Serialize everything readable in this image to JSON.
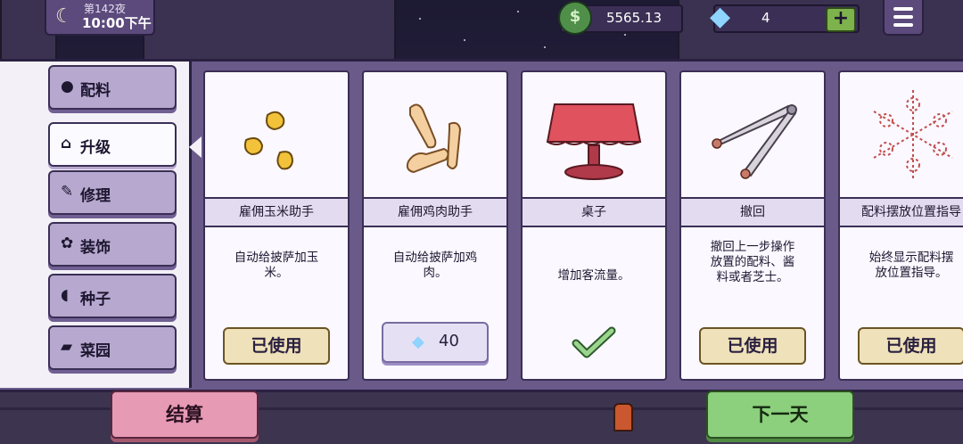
{
  "hud": {
    "night_label": "第142夜",
    "time": "10:00下午",
    "money": "5565.13",
    "gems": "4",
    "add_label": "+"
  },
  "sidebar": {
    "items": [
      {
        "label": "配料",
        "icon": "mushroom-icon",
        "glyph": "●"
      },
      {
        "label": "升级",
        "icon": "home-icon",
        "glyph": "⌂"
      },
      {
        "label": "修理",
        "icon": "wrench-icon",
        "glyph": "✎"
      },
      {
        "label": "装饰",
        "icon": "plant-icon",
        "glyph": "✿"
      },
      {
        "label": "种子",
        "icon": "seed-icon",
        "glyph": "◖"
      },
      {
        "label": "菜园",
        "icon": "wheelbarrow-icon",
        "glyph": "▰"
      }
    ],
    "active_index": 1
  },
  "cards": [
    {
      "name": "雇佣玉米助手",
      "desc_lines": [
        "自动给披萨加玉",
        "米。"
      ],
      "status": "已使用",
      "art": "corn-icon"
    },
    {
      "name": "雇佣鸡肉助手",
      "desc_lines": [
        "自动给披萨加鸡",
        "肉。"
      ],
      "price": "40",
      "art": "chicken-icon"
    },
    {
      "name": "桌子",
      "desc_lines": [
        "增加客流量。"
      ],
      "status": "purchased",
      "art": "table-icon"
    },
    {
      "name": "撤回",
      "desc_lines": [
        "撤回上一步操作",
        "放置的配料、酱",
        "料或者芝士。"
      ],
      "status": "已使用",
      "art": "tongs-icon"
    },
    {
      "name": "配料摆放位置指导",
      "desc_lines": [
        "始终显示配料摆",
        "放位置指导。"
      ],
      "status": "已使用",
      "art": "placement-guide-icon"
    }
  ],
  "buttons": {
    "settle": "结算",
    "next_day": "下一天"
  },
  "colors": {
    "panel": "#6a5a8a",
    "sidebar": "#f3f0f7",
    "settle": "#e79ab4",
    "next_day": "#8ccf7d",
    "used_button": "#efe1b9",
    "gem": "#8fd3ff"
  }
}
